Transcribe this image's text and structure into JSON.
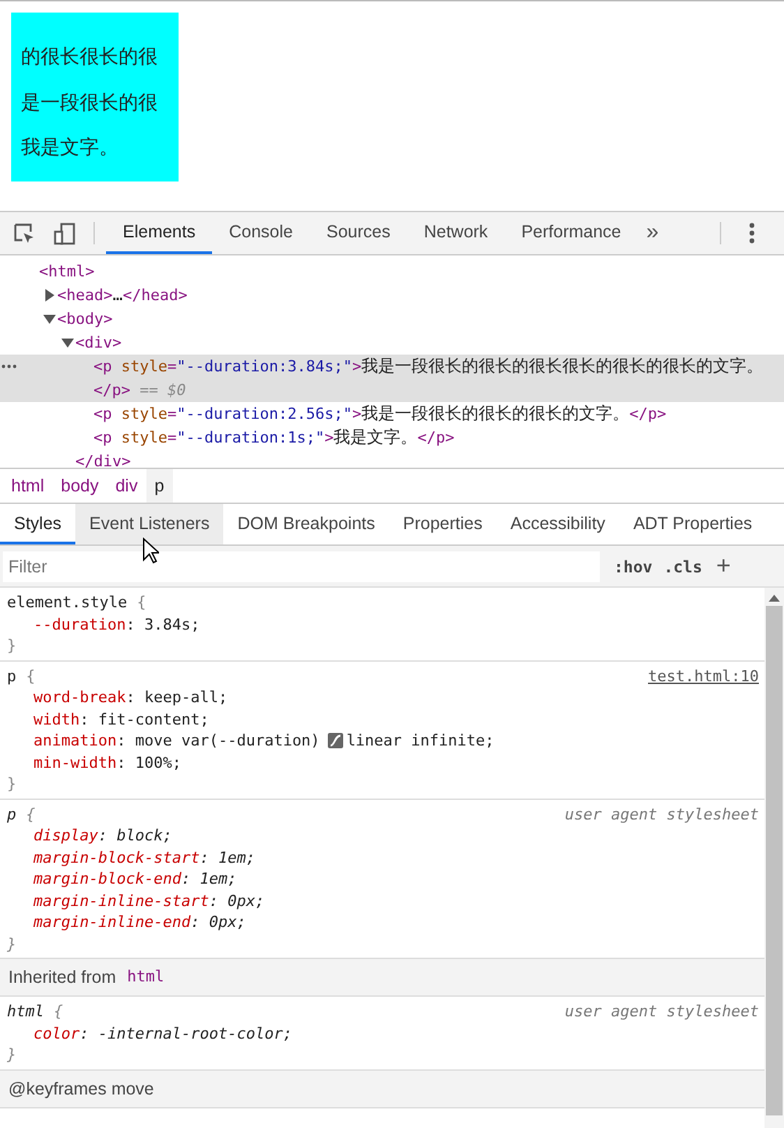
{
  "preview": {
    "lines": [
      "的很长很长的很",
      "是一段很长的很",
      "我是文字。"
    ]
  },
  "toolbar": {
    "tabs": [
      {
        "label": "Elements",
        "selected": true
      },
      {
        "label": "Console",
        "selected": false
      },
      {
        "label": "Sources",
        "selected": false
      },
      {
        "label": "Network",
        "selected": false
      },
      {
        "label": "Performance",
        "selected": false
      }
    ],
    "more": "»"
  },
  "dom_tree": [
    {
      "segments": [
        {
          "kind": "tag",
          "text": "<html>"
        }
      ],
      "children": [
        {
          "expanded": false,
          "selected": false,
          "segments": [
            {
              "kind": "tag",
              "text": "<head>"
            },
            {
              "kind": "text",
              "text": "…"
            },
            {
              "kind": "tag",
              "text": "</head>"
            }
          ]
        },
        {
          "expanded": true,
          "selected": false,
          "segments": [
            {
              "kind": "tag",
              "text": "<body>"
            }
          ],
          "children": [
            {
              "expanded": true,
              "selected": false,
              "segments": [
                {
                  "kind": "tag",
                  "text": "<div>"
                }
              ],
              "closing": "</div>",
              "children": [
                {
                  "selected": true,
                  "segments": [
                    {
                      "kind": "tag",
                      "text": "<p "
                    },
                    {
                      "kind": "attr",
                      "text": "style"
                    },
                    {
                      "kind": "tag",
                      "text": "="
                    },
                    {
                      "kind": "value",
                      "text": "\"--duration:3.84s;\""
                    },
                    {
                      "kind": "tag",
                      "text": ">"
                    },
                    {
                      "kind": "text",
                      "text": "我是一段很长的很长的很长很长的很长的很长的文字。"
                    },
                    {
                      "kind": "tag",
                      "text": "</p>"
                    },
                    {
                      "kind": "hint",
                      "text": " == $0"
                    }
                  ]
                },
                {
                  "selected": false,
                  "segments": [
                    {
                      "kind": "tag",
                      "text": "<p "
                    },
                    {
                      "kind": "attr",
                      "text": "style"
                    },
                    {
                      "kind": "tag",
                      "text": "="
                    },
                    {
                      "kind": "value",
                      "text": "\"--duration:2.56s;\""
                    },
                    {
                      "kind": "tag",
                      "text": ">"
                    },
                    {
                      "kind": "text",
                      "text": "我是一段很长的很长的很长的文字。"
                    },
                    {
                      "kind": "tag",
                      "text": "</p>"
                    }
                  ]
                },
                {
                  "selected": false,
                  "segments": [
                    {
                      "kind": "tag",
                      "text": "<p "
                    },
                    {
                      "kind": "attr",
                      "text": "style"
                    },
                    {
                      "kind": "tag",
                      "text": "="
                    },
                    {
                      "kind": "value",
                      "text": "\"--duration:1s;\""
                    },
                    {
                      "kind": "tag",
                      "text": ">"
                    },
                    {
                      "kind": "text",
                      "text": "我是文字。"
                    },
                    {
                      "kind": "tag",
                      "text": "</p>"
                    }
                  ]
                }
              ]
            }
          ]
        }
      ]
    }
  ],
  "breadcrumbs": [
    {
      "label": "html",
      "selected": false
    },
    {
      "label": "body",
      "selected": false
    },
    {
      "label": "div",
      "selected": false
    },
    {
      "label": "p",
      "selected": true
    }
  ],
  "sidebar_tabs": [
    {
      "label": "Styles",
      "selected": true
    },
    {
      "label": "Event Listeners",
      "selected": false
    },
    {
      "label": "DOM Breakpoints",
      "selected": false
    },
    {
      "label": "Properties",
      "selected": false
    },
    {
      "label": "Accessibility",
      "selected": false
    },
    {
      "label": "ADT Properties",
      "selected": false
    }
  ],
  "filter": {
    "placeholder": "Filter",
    "hov": ":hov",
    "cls": ".cls",
    "add": "+"
  },
  "styles": [
    {
      "kind": "rule",
      "selector": "element.style",
      "open": "{",
      "close": "}",
      "user_agent": false,
      "declarations": [
        {
          "kind": "plain",
          "property": "--duration",
          "value": ": 3.84s;"
        }
      ]
    },
    {
      "kind": "rule",
      "selector": "p",
      "open": "{",
      "close": "}",
      "source": "test.html:10",
      "user_agent": false,
      "declarations": [
        {
          "kind": "plain",
          "property": "word-break",
          "value": ": keep-all;"
        },
        {
          "kind": "plain",
          "property": "width",
          "value": ": fit-content;"
        },
        {
          "kind": "easing",
          "property": "animation",
          "value": ": move var(--duration)",
          "value_after": "linear infinite;"
        },
        {
          "kind": "plain",
          "property": "min-width",
          "value": ": 100%;"
        }
      ]
    },
    {
      "kind": "rule",
      "selector": "p",
      "open": "{",
      "close": "}",
      "source": "user agent stylesheet",
      "user_agent": true,
      "declarations": [
        {
          "kind": "plain",
          "property": "display",
          "value": ": block;"
        },
        {
          "kind": "plain",
          "property": "margin-block-start",
          "value": ": 1em;"
        },
        {
          "kind": "plain",
          "property": "margin-block-end",
          "value": ": 1em;"
        },
        {
          "kind": "plain",
          "property": "margin-inline-start",
          "value": ": 0px;"
        },
        {
          "kind": "plain",
          "property": "margin-inline-end",
          "value": ": 0px;"
        }
      ]
    },
    {
      "kind": "header",
      "text": "Inherited from",
      "tag": "html"
    },
    {
      "kind": "rule",
      "selector": "html",
      "open": "{",
      "close": "}",
      "source": "user agent stylesheet",
      "user_agent": true,
      "declarations": [
        {
          "kind": "plain",
          "property": "color",
          "value": ": -internal-root-color;"
        }
      ]
    },
    {
      "kind": "header",
      "text": "@keyframes move"
    }
  ]
}
